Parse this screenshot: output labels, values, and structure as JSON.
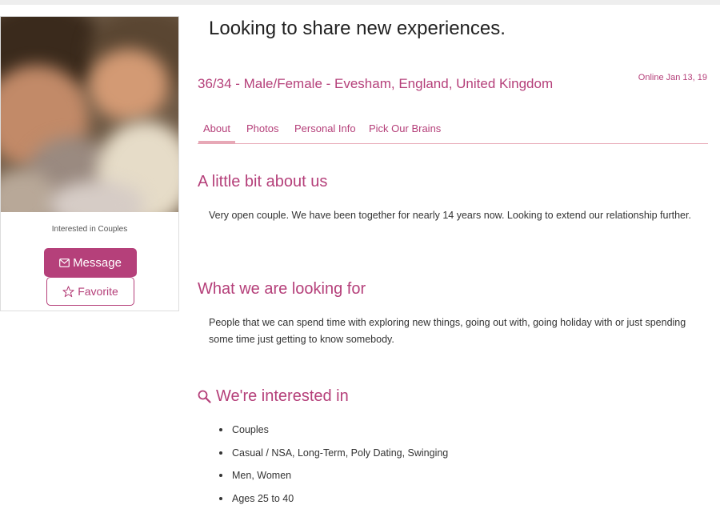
{
  "profile": {
    "interested_in": "Interested in Couples",
    "message_label": "Message",
    "favorite_label": "Favorite"
  },
  "header": {
    "headline": "Looking to share new experiences.",
    "meta": "36/34 - Male/Female - Evesham, England, United Kingdom",
    "online": "Online Jan 13, 19"
  },
  "tabs": [
    {
      "label": "About",
      "active": true
    },
    {
      "label": "Photos",
      "active": false
    },
    {
      "label": "Personal Info",
      "active": false
    },
    {
      "label": "Pick Our Brains",
      "active": false
    }
  ],
  "about": {
    "title": "A little bit about us",
    "body": "Very open couple. We have been together for nearly 14 years now. Looking to extend our relationship further."
  },
  "looking_for": {
    "title": "What we are looking for",
    "body": "People that we can spend time with exploring new things, going out with, going holiday with or just spending some time just getting to know somebody."
  },
  "interests": {
    "title": "We're interested in",
    "items": [
      "Couples",
      "Casual / NSA, Long-Term, Poly Dating, Swinging",
      "Men, Women",
      "Ages 25 to 40"
    ]
  },
  "colors": {
    "accent": "#b5407a",
    "tab_underline": "#e7a8b6"
  }
}
